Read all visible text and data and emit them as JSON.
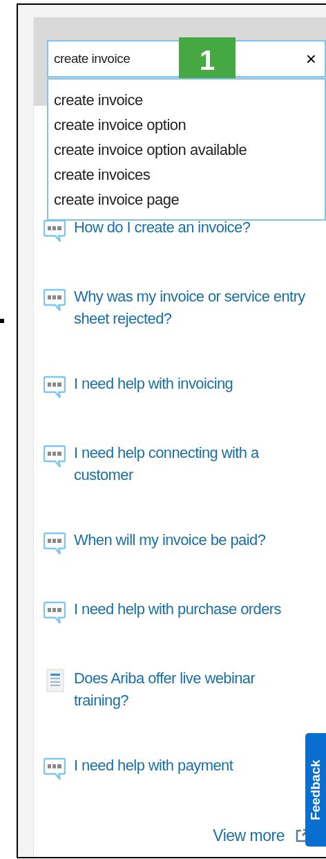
{
  "search": {
    "value": "create invoice",
    "clear": "×"
  },
  "badge": "1",
  "suggestions": [
    "create invoice",
    "create invoice option",
    "create invoice option available",
    "create invoices",
    "create invoice page"
  ],
  "results": [
    {
      "kind": "faq",
      "title": "How do I create an invoice?"
    },
    {
      "kind": "faq",
      "title": "Why was my invoice or service entry sheet rejected?"
    },
    {
      "kind": "faq",
      "title": "I need help with invoicing"
    },
    {
      "kind": "faq",
      "title": "I need help connecting with a customer"
    },
    {
      "kind": "faq",
      "title": "When will my invoice be paid?"
    },
    {
      "kind": "faq",
      "title": "I need help with purchase orders"
    },
    {
      "kind": "document",
      "title": "Does Ariba offer live webinar training?"
    },
    {
      "kind": "faq",
      "title": "I need help with payment"
    }
  ],
  "view_more": "View more",
  "feedback": "Feedback"
}
